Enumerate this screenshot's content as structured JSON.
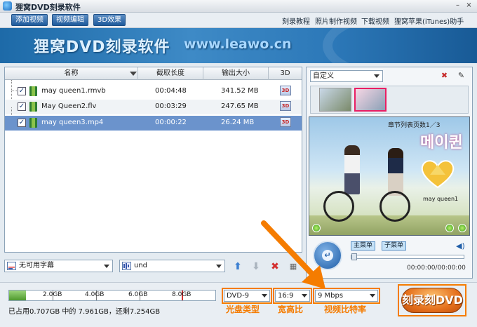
{
  "titlebar": {
    "title": "狸窝DVD刻录软件",
    "min": "–",
    "close": "×"
  },
  "toolbar": {
    "add_video": "添加视频",
    "edit_video": "视频编辑",
    "effect_3d": "3D效果",
    "links": [
      "刻录教程",
      "照片制作视频",
      "下载视频",
      "狸窝苹果(iTunes)助手"
    ]
  },
  "banner": {
    "title": "狸窝DVD刻录软件",
    "url": "www.leawo.cn"
  },
  "filelist": {
    "headers": [
      "名称",
      "截取长度",
      "输出大小",
      "3D"
    ],
    "rows": [
      {
        "name": "may queen1.rmvb",
        "duration": "00:04:48",
        "size": "341.52 MB",
        "badge": "3D"
      },
      {
        "name": "May Queen2.flv",
        "duration": "00:03:29",
        "size": "247.65 MB",
        "badge": "3D"
      },
      {
        "name": "may queen3.mp4",
        "duration": "00:00:22",
        "size": "26.24 MB",
        "badge": "3D"
      }
    ],
    "checkmark": "✓"
  },
  "bottom": {
    "subtitle_value": "无可用字幕",
    "audio_value": "und"
  },
  "preview": {
    "theme_value": "自定义",
    "menu_title": "章节列表页数1／3",
    "logo_text": "메이퀸",
    "clip_label": "may queen1",
    "main_menu": "主菜单",
    "sub_menu": "子菜单",
    "timecode": "00:00:00/00:00:00",
    "play_symbol": "↵"
  },
  "status": {
    "capacity_labels": [
      "2.0GB",
      "4.0GB",
      "6.0GB",
      "8.0GB"
    ],
    "capacity_fill_fraction": 0.08,
    "usage_text": "已占用0.707GB 中的 7.961GB，还剩7.254GB",
    "disc_type": "DVD-9",
    "aspect": "16:9",
    "bitrate": "9 Mbps",
    "disc_type_label": "光盘类型",
    "aspect_label": "宽高比",
    "bitrate_label": "视频比特率",
    "burn_label": "刻录刻DVD"
  },
  "colors": {
    "accent_orange": "#f57c00",
    "selected_row": "#6b93cc",
    "banner_blue": "#2c78b8"
  }
}
